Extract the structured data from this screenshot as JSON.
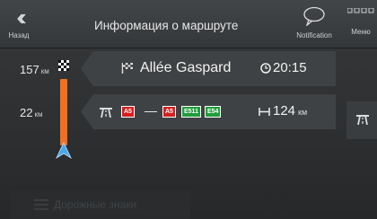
{
  "header": {
    "back_label": "Назад",
    "title": "Информация о маршруте",
    "notification_label": "Notification",
    "menu_label": "Меню"
  },
  "left_rail": {
    "dist_to_dest": "157",
    "dist_to_dest_unit": "км",
    "dist_to_road": "22",
    "dist_to_road_unit": "км"
  },
  "route": {
    "destination": "Allée Gaspard",
    "eta": "20:15",
    "road_shields": [
      {
        "label": "A5",
        "color": "#d32020"
      },
      {
        "label": "A5",
        "color": "#d32020"
      },
      {
        "label": "E511",
        "color": "#219d3c"
      },
      {
        "label": "E54",
        "color": "#219d3c"
      }
    ],
    "road_dash": "—",
    "road_length": "124",
    "road_length_unit": "км"
  },
  "footer": {
    "button_label": "Дорожные знаки"
  },
  "colors": {
    "route_bar": "#f07020",
    "nav_arrow": "#4aa8e8"
  }
}
